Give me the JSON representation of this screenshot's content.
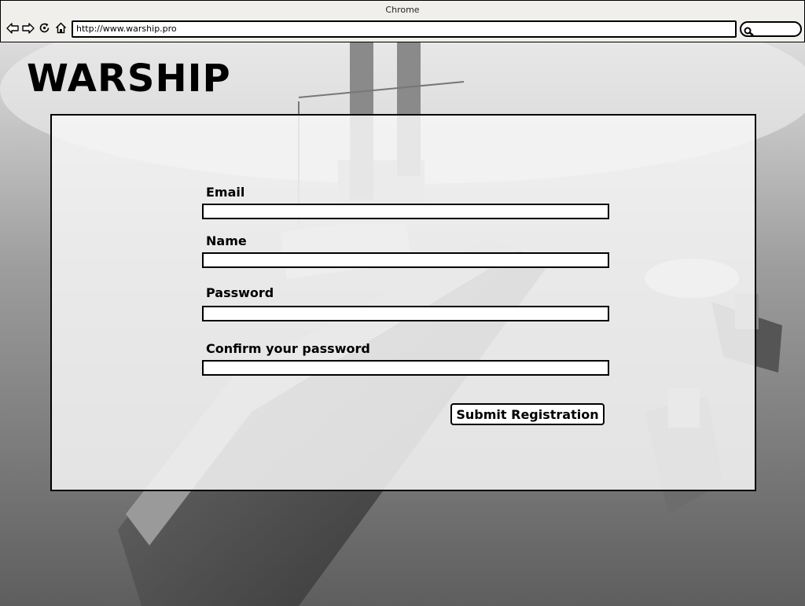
{
  "browser": {
    "window_title": "Chrome",
    "url": "http://www.warship.pro",
    "icons": [
      "back-arrow-icon",
      "forward-arrow-icon",
      "reload-icon",
      "home-icon",
      "search-icon"
    ]
  },
  "page": {
    "title": "WARSHIP",
    "form": {
      "fields": [
        {
          "label": "Email",
          "value": ""
        },
        {
          "label": "Name",
          "value": ""
        },
        {
          "label": "Password",
          "value": ""
        },
        {
          "label": "Confirm your password",
          "value": ""
        }
      ],
      "submit_label": "Submit Registration"
    }
  },
  "colors": {
    "chrome_bg": "#f1efec",
    "panel_bg": "#f6f6f6",
    "border": "#000000"
  }
}
